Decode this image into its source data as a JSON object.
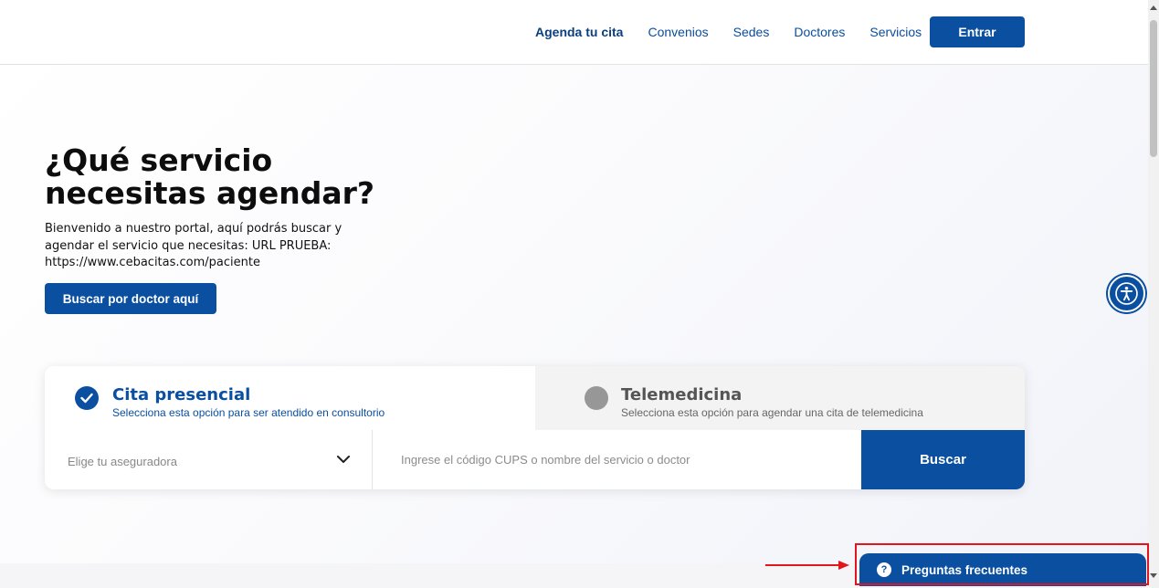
{
  "header": {
    "nav": [
      "Agenda tu cita",
      "Convenios",
      "Sedes",
      "Doctores",
      "Servicios"
    ],
    "login_label": "Entrar"
  },
  "hero": {
    "title_line1": "¿Qué servicio",
    "title_line2": "necesitas agendar?",
    "desc_line1": "Bienvenido a nuestro portal, aquí podrás buscar y",
    "desc_line2": "agendar el servicio que necesitas: URL PRUEBA:",
    "desc_line3": "https://www.cebacitas.com/paciente",
    "doctor_button": "Buscar por doctor aquí"
  },
  "search": {
    "tabs": [
      {
        "title": "Cita presencial",
        "subtitle": "Selecciona esta opción para ser atendido en consultorio",
        "selected": true
      },
      {
        "title": "Telemedicina",
        "subtitle": "Selecciona esta opción para agendar una cita de telemedicina",
        "selected": false
      }
    ],
    "insurer_placeholder": "Elige tu aseguradora",
    "query_placeholder": "Ingrese el código CUPS o nombre del servicio o doctor",
    "search_button": "Buscar"
  },
  "faq": {
    "label": "Preguntas frecuentes",
    "icon": "question-icon"
  },
  "icons": {
    "accessibility": "accessibility-icon",
    "check": "check-icon",
    "chevron": "chevron-down-icon"
  },
  "colors": {
    "brand": "#0a4fa0",
    "highlight": "#e0151e"
  }
}
